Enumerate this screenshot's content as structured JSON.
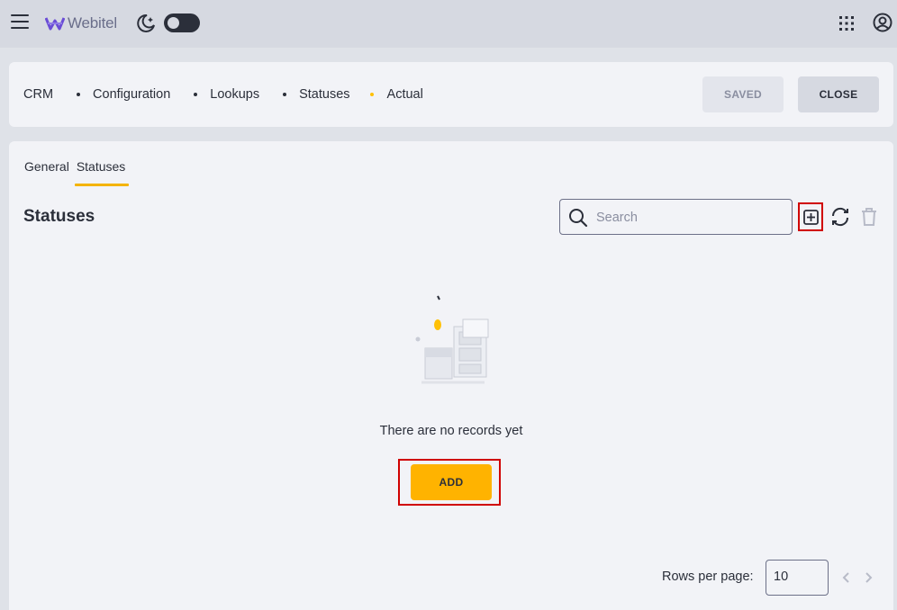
{
  "app": {
    "logo_text": "Webitel"
  },
  "breadcrumb": [
    "CRM",
    "Configuration",
    "Lookups",
    "Statuses",
    "Actual"
  ],
  "header": {
    "saved_label": "SAVED",
    "close_label": "CLOSE"
  },
  "tabs": [
    {
      "label": "General",
      "active": false
    },
    {
      "label": "Statuses",
      "active": true
    }
  ],
  "section": {
    "title": "Statuses",
    "search_placeholder": "Search"
  },
  "empty_state": {
    "message": "There are no records yet",
    "add_label": "ADD"
  },
  "pagination": {
    "rows_label": "Rows per page:",
    "rows_value": "10"
  },
  "colors": {
    "accent": "#ffb300",
    "highlight": "#d00000",
    "logo": "#6a4cd6"
  }
}
